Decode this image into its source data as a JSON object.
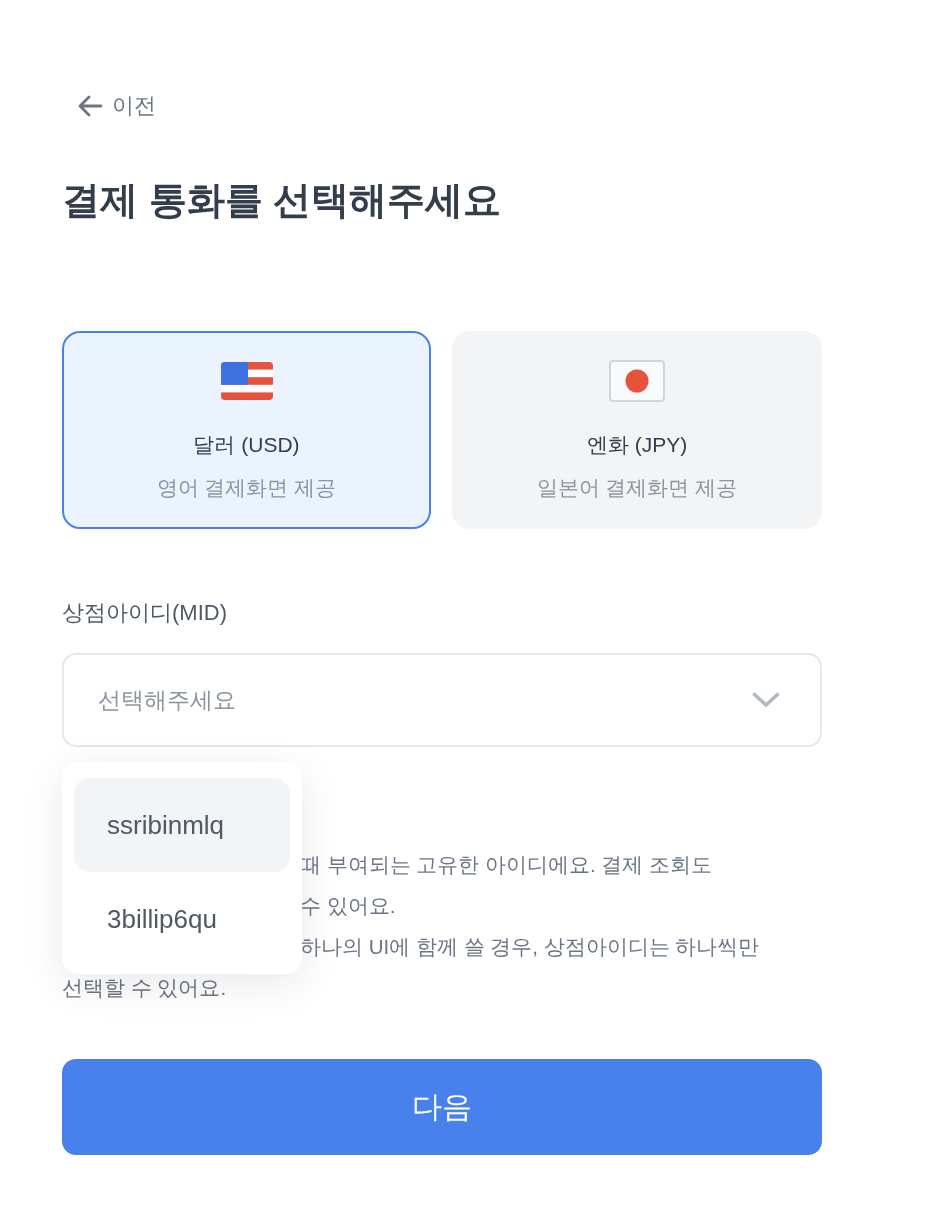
{
  "back_link": {
    "label": "이전"
  },
  "title": "결제 통화를 선택해주세요",
  "currencies": [
    {
      "kind": "usd",
      "name": "달러 (USD)",
      "description": "영어 결제화면 제공",
      "selected": true
    },
    {
      "kind": "jpy",
      "name": "엔화 (JPY)",
      "description": "일본어 결제화면 제공",
      "selected": false
    }
  ],
  "merchant_id": {
    "label": "상점아이디(MID)",
    "placeholder": "선택해주세요",
    "expanded": true,
    "options": [
      {
        "label": "ssribinmlq",
        "selected": true
      },
      {
        "label": "3billip6qu",
        "selected": false
      }
    ]
  },
  "help_text": {
    "partly_hidden_lines": [
      "때 부여되는 고유한 아이디에요. 결제 조회도",
      "수 있어요.",
      "하나의 UI에 함께 쓸 경우, 상점아이디는 하나씩만"
    ],
    "last_line": "선택할 수 있어요."
  },
  "next_button": {
    "label": "다음"
  }
}
